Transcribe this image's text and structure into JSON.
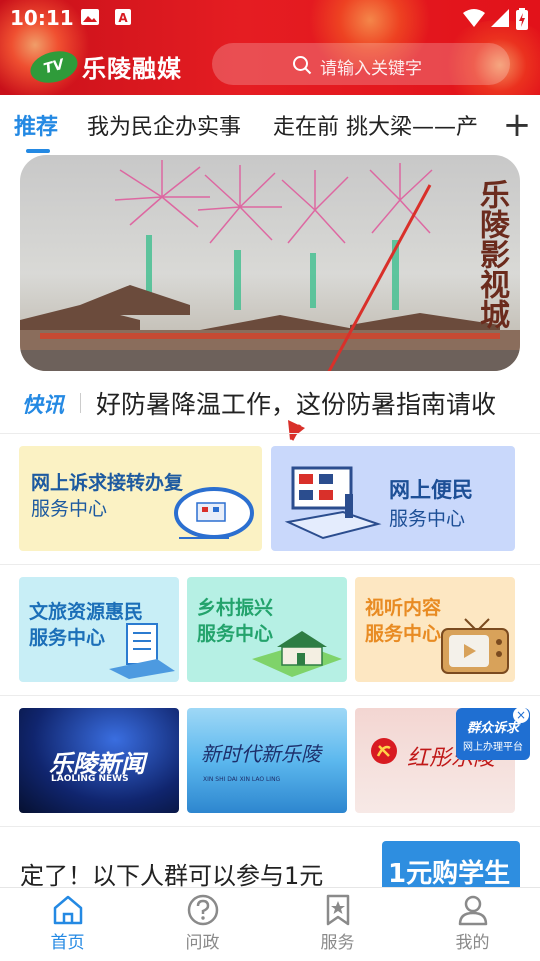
{
  "status": {
    "time": "10:11"
  },
  "header": {
    "logo_badge": "TV",
    "app_name": "乐陵融媒",
    "search_placeholder": "请输入关键字"
  },
  "tabs": [
    {
      "label": "推荐",
      "active": true
    },
    {
      "label": "我为民企办实事"
    },
    {
      "label": "走在前 挑大梁——产"
    }
  ],
  "tabs_more": "+",
  "banner": {
    "title": "乐陵影视城"
  },
  "ticker": {
    "tag": "快讯",
    "text": "好防暑降温工作，这份防暑指南请收"
  },
  "services_row1": [
    {
      "title": "网上诉求接转办复",
      "subtitle": "服务中心",
      "bg": "#fbf2c4",
      "color": "#1d5aa0"
    },
    {
      "title": "网上便民",
      "subtitle": "服务中心",
      "bg": "#c9d8fb",
      "color": "#1d4f96"
    }
  ],
  "services_row2": [
    {
      "line1": "文旅资源惠民",
      "line2": "服务中心",
      "bg": "#c8eef6",
      "color": "#1c6fb8"
    },
    {
      "line1": "乡村振兴",
      "line2": "服务中心",
      "bg": "#b6f0e4",
      "color": "#23a36c"
    },
    {
      "line1": "视听内容",
      "line2": "服务中心",
      "bg": "#fde7c2",
      "color": "#e88b23"
    }
  ],
  "channels": [
    {
      "label": "乐陵新闻",
      "sub": "LAOLING NEWS"
    },
    {
      "label": "新时代新乐陵",
      "sub": "XIN SHI DAI XIN LAO LING"
    },
    {
      "label": "红彤乐陵"
    }
  ],
  "float": {
    "line1": "群众诉求",
    "line2": "网上办理平台",
    "close": "×"
  },
  "news": {
    "title": "定了！以下人群可以参与1元",
    "thumb_text": "1元购学生"
  },
  "bottom_nav": [
    {
      "label": "首页",
      "icon": "home-icon",
      "active": true
    },
    {
      "label": "问政",
      "icon": "question-icon"
    },
    {
      "label": "服务",
      "icon": "bookmark-star-icon"
    },
    {
      "label": "我的",
      "icon": "user-icon"
    }
  ],
  "colors": {
    "header_red": "#e51d22",
    "accent_blue": "#2489e3"
  }
}
